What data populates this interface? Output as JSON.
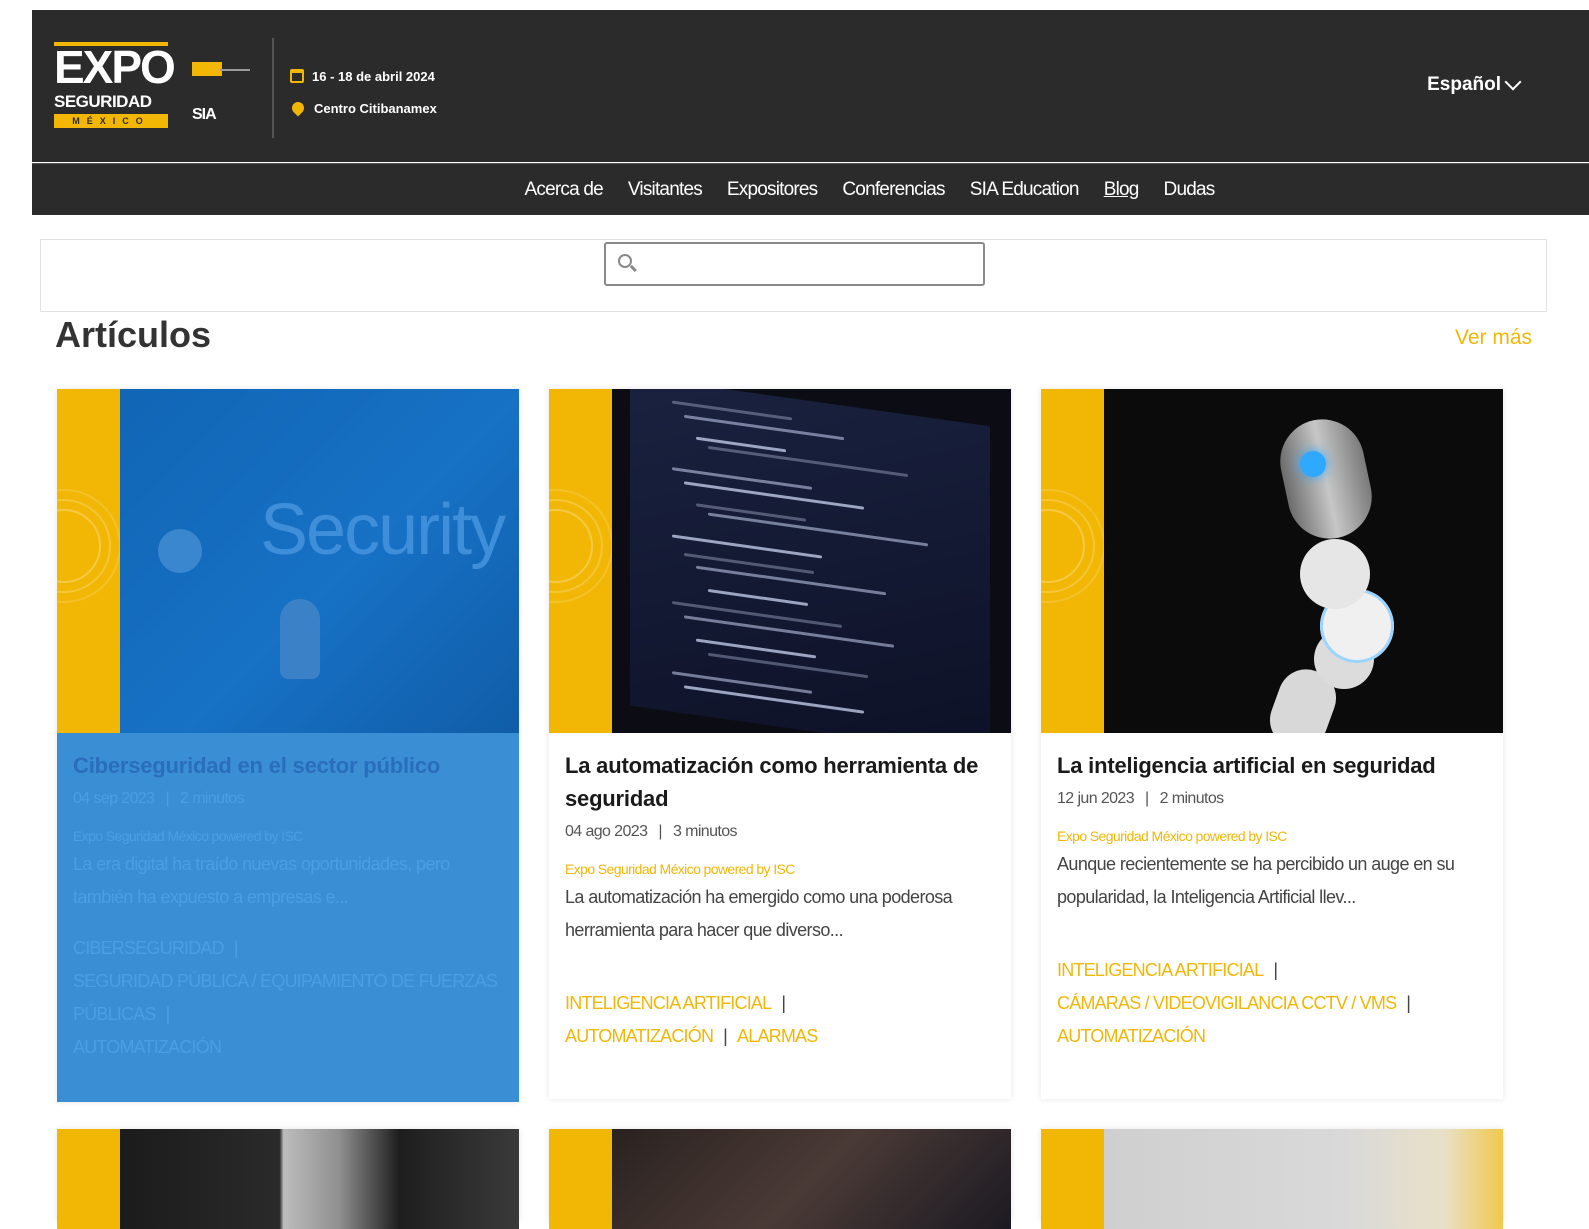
{
  "header": {
    "logo_text_main": "EXPO",
    "logo_text_sub": "SEGURIDAD",
    "logo_text_country": "MÉXICO",
    "partner_logo": "SIA",
    "event_dates": "16 - 18 de abril 2024",
    "event_venue": "Centro Citibanamex",
    "calendar_icon": "calendar-icon",
    "location_icon": "location-pin-icon",
    "language": "Español"
  },
  "nav": {
    "items": [
      "Acerca de",
      "Visitantes",
      "Expositores",
      "Conferencias",
      "SIA Education",
      "Blog",
      "Dudas"
    ],
    "active": "Blog"
  },
  "search": {
    "placeholder": "",
    "icon": "search-icon"
  },
  "section": {
    "title": "Artículos",
    "more_link": "Ver más"
  },
  "articles": [
    {
      "title": "Ciberseguridad en el sector público",
      "date": "04 sep 2023",
      "read_time": "2 minutos",
      "author": "Expo Seguridad México powered by ISC",
      "excerpt": "La era digital ha traído nuevas oportunidades, pero también ha expuesto a empresas e...",
      "tags": [
        "CIBERSEGURIDAD",
        "SEGURIDAD PÚBLICA / EQUIPAMIENTO DE FUERZAS PÚBLICAS",
        "AUTOMATIZACIÓN"
      ],
      "image_word": "Security"
    },
    {
      "title": "La automatización como herramienta de seguridad",
      "date": "04 ago 2023",
      "read_time": "3 minutos",
      "author": "Expo Seguridad México powered by ISC",
      "excerpt": "La automatización ha emergido como una poderosa herramienta para hacer que diverso...",
      "tags": [
        "INTELIGENCIA ARTIFICIAL",
        "AUTOMATIZACIÓN",
        "ALARMAS"
      ]
    },
    {
      "title": "La inteligencia artificial en seguridad",
      "date": "12 jun 2023",
      "read_time": "2 minutos",
      "author": "Expo Seguridad México powered by ISC",
      "excerpt": "Aunque recientemente se ha percibido un auge en su popularidad, la Inteligencia Artificial llev...",
      "tags": [
        "INTELIGENCIA ARTIFICIAL",
        "CÁMARAS / VIDEOVIGILANCIA CCTV / VMS",
        "AUTOMATIZACIÓN"
      ]
    }
  ],
  "colors": {
    "accent": "#f2b705",
    "header_bg": "#2b2b2b",
    "selection": "#3a8fd4"
  }
}
